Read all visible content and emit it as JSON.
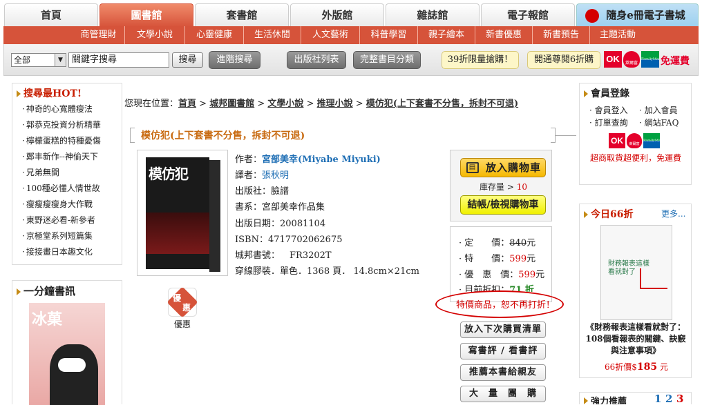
{
  "nav": {
    "tabs": [
      "首頁",
      "圖書館",
      "套書館",
      "外版館",
      "雜誌館",
      "電子報館",
      "隨身e冊電子書城"
    ],
    "sub": [
      "商管理財",
      "文學小說",
      "心靈健康",
      "生活休閒",
      "人文藝術",
      "科普學習",
      "親子繪本",
      "新書優惠",
      "新書預告",
      "主題活動"
    ]
  },
  "search": {
    "select": "全部",
    "input": "關鍵字搜尋",
    "btn": "搜尋",
    "adv": "進階搜尋",
    "pub": "出版社列表",
    "cat": "完整書目分類",
    "promo1": "39折限量搶購！",
    "promo2": "開通尊閱6折購",
    "free": "免運費",
    "ok": "OK",
    "hilife": "萊爾富",
    "fm": "FamilyMart"
  },
  "left": {
    "hot_title": "搜尋最HOT!",
    "hot": [
      "神奇的心寬體瘦法",
      "郭恭克投資分析精華",
      "檸檬蛋糕的特種憂傷",
      "鄭丰新作--神偷天下",
      "兄弟無間",
      "100種必懂人情世故",
      "瘦瘦瘦瘦身大作戰",
      "東野迷必看-新參者",
      "京極堂系列短篇集",
      "接接畫日本趣文化"
    ],
    "minute_title": "一分鐘書訊",
    "minute_book": "冰菓"
  },
  "crumb": {
    "prefix": "您現在位置：",
    "items": [
      "首頁",
      "城邦圖書館",
      "文學小說",
      "推理小說",
      "模仿犯(上下套書不分售，拆封不可退)"
    ],
    "sep": ">"
  },
  "book": {
    "title": "模仿犯(上下套書不分售，拆封不可退)",
    "cover_title": "模仿犯",
    "author_label": "作者：",
    "author": "宮部美幸(Miyabe Miyuki)",
    "translator_label": "譯者：",
    "translator": "張秋明",
    "publisher": "出版社：臉譜",
    "series": "書系：宮部美幸作品集",
    "date": "出版日期：20081104",
    "isbn": "ISBN：4717702062675",
    "code_label": "城邦書號：",
    "code": "FR3202T",
    "spec": "穿線膠裝．單色．1368 頁． 14.8cm×21cm",
    "badge_top": "優",
    "badge_bottom": "惠",
    "badge_label": "優惠"
  },
  "buy": {
    "cart": "放入購物車",
    "stock_label": "庫存量 >",
    "stock": "10",
    "checkout": "結帳/檢視購物車",
    "list_price_label": "定　　價：",
    "list_price": "840",
    "special_label": "特　　價：",
    "special": "599",
    "discount_label": "優　惠　價：",
    "discount": "599",
    "yuan": "元",
    "current_label": "目前折扣：",
    "current": "71 折",
    "note": "特價商品，恕不再打折！",
    "btns": [
      "放入下次購買清單",
      "寫書評 / 看書評",
      "推薦本書給親友",
      "大　量　團　購"
    ]
  },
  "right": {
    "member_title": "會員登錄",
    "links": [
      "會員登入",
      "加入會員",
      "訂單查詢",
      "網站FAQ"
    ],
    "store_note": "超商取貨超便利，免運費",
    "today_title": "今日66折",
    "more": "更多...",
    "today_book": "《財務報表這樣看就對了：108個看報表的關鍵、訣竅與注意事項》",
    "today_price_label": "66折價$",
    "today_price": "185",
    "today_yuan": "元",
    "today_cover": "財務報表這樣看就對了",
    "bottom_title": "強力推薦",
    "bottom_nums": [
      "1",
      "2",
      "3"
    ]
  },
  "colors": {
    "accent": "#d6533a",
    "price": "#d40000",
    "link": "#1f6fb5"
  }
}
